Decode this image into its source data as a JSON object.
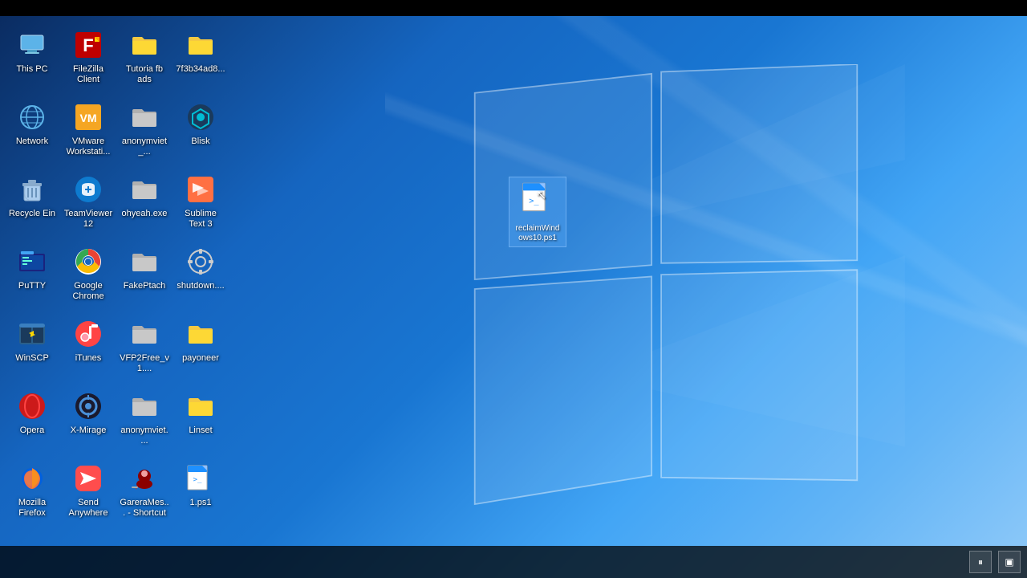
{
  "desktop": {
    "icons": [
      {
        "id": "this-pc",
        "label": "This PC",
        "type": "this-pc",
        "row": 0,
        "col": 0
      },
      {
        "id": "filezilla",
        "label": "FileZilla Client",
        "type": "filezilla",
        "row": 0,
        "col": 1
      },
      {
        "id": "tutoria-fbads",
        "label": "Tutoria fb ads",
        "type": "folder-yellow",
        "row": 0,
        "col": 2
      },
      {
        "id": "7f3b34ad8",
        "label": "7f3b34ad8...",
        "type": "folder-yellow",
        "row": 0,
        "col": 3
      },
      {
        "id": "network",
        "label": "Network",
        "type": "network",
        "row": 1,
        "col": 0
      },
      {
        "id": "vmware",
        "label": "VMware Workstati...",
        "type": "vmware",
        "row": 1,
        "col": 1
      },
      {
        "id": "anonymviet",
        "label": "anonymviet_...",
        "type": "folder-plain",
        "row": 1,
        "col": 2
      },
      {
        "id": "blisk",
        "label": "Blisk",
        "type": "blisk",
        "row": 1,
        "col": 3
      },
      {
        "id": "recycle-bin",
        "label": "Recycle Ein",
        "type": "recycle",
        "row": 2,
        "col": 0
      },
      {
        "id": "teamviewer",
        "label": "TeamViewer 12",
        "type": "teamviewer",
        "row": 2,
        "col": 1
      },
      {
        "id": "ohyeah",
        "label": "ohyeah.exe",
        "type": "folder-plain",
        "row": 2,
        "col": 2
      },
      {
        "id": "sublime",
        "label": "Sublime Text 3",
        "type": "sublime",
        "row": 2,
        "col": 3
      },
      {
        "id": "putty",
        "label": "PuTTY",
        "type": "putty",
        "row": 3,
        "col": 0
      },
      {
        "id": "chrome",
        "label": "Google Chrome",
        "type": "chrome",
        "row": 3,
        "col": 1
      },
      {
        "id": "fakeptach",
        "label": "FakePtach",
        "type": "folder-plain",
        "row": 3,
        "col": 2
      },
      {
        "id": "shutdown",
        "label": "shutdown....",
        "type": "gear",
        "row": 3,
        "col": 3
      },
      {
        "id": "winscp",
        "label": "WinSCP",
        "type": "winscp",
        "row": 4,
        "col": 0
      },
      {
        "id": "itunes",
        "label": "iTunes",
        "type": "itunes",
        "row": 4,
        "col": 1
      },
      {
        "id": "vfp2free",
        "label": "VFP2Free_v1....",
        "type": "folder-plain",
        "row": 4,
        "col": 2
      },
      {
        "id": "payoneer",
        "label": "payoneer",
        "type": "folder-yellow",
        "row": 4,
        "col": 3
      },
      {
        "id": "opera",
        "label": "Opera",
        "type": "opera",
        "row": 5,
        "col": 0
      },
      {
        "id": "x-mirage",
        "label": "X-Mirage",
        "type": "x-mirage",
        "row": 5,
        "col": 1
      },
      {
        "id": "anonymviet2",
        "label": "anonymviet....",
        "type": "folder-plain",
        "row": 5,
        "col": 2
      },
      {
        "id": "linset",
        "label": "Linset",
        "type": "folder-yellow",
        "row": 5,
        "col": 3
      },
      {
        "id": "firefox",
        "label": "Mozilla Firefox",
        "type": "firefox",
        "row": 6,
        "col": 0
      },
      {
        "id": "send-anywhere",
        "label": "Send Anywhere",
        "type": "send-anywhere",
        "row": 6,
        "col": 1
      },
      {
        "id": "garera-mes",
        "label": "GareraMes... - Shortcut",
        "type": "garera",
        "row": 6,
        "col": 2
      },
      {
        "id": "1ps1",
        "label": "1.ps1",
        "type": "powershell",
        "row": 6,
        "col": 3
      }
    ],
    "floating_file": {
      "label": "reclaimWindows10.ps1",
      "type": "powershell"
    }
  },
  "taskbar": {
    "buttons": [
      {
        "id": "pause-btn",
        "label": "⏸",
        "symbol": "⏸"
      },
      {
        "id": "square-btn",
        "label": "▣",
        "symbol": "▣"
      }
    ]
  }
}
